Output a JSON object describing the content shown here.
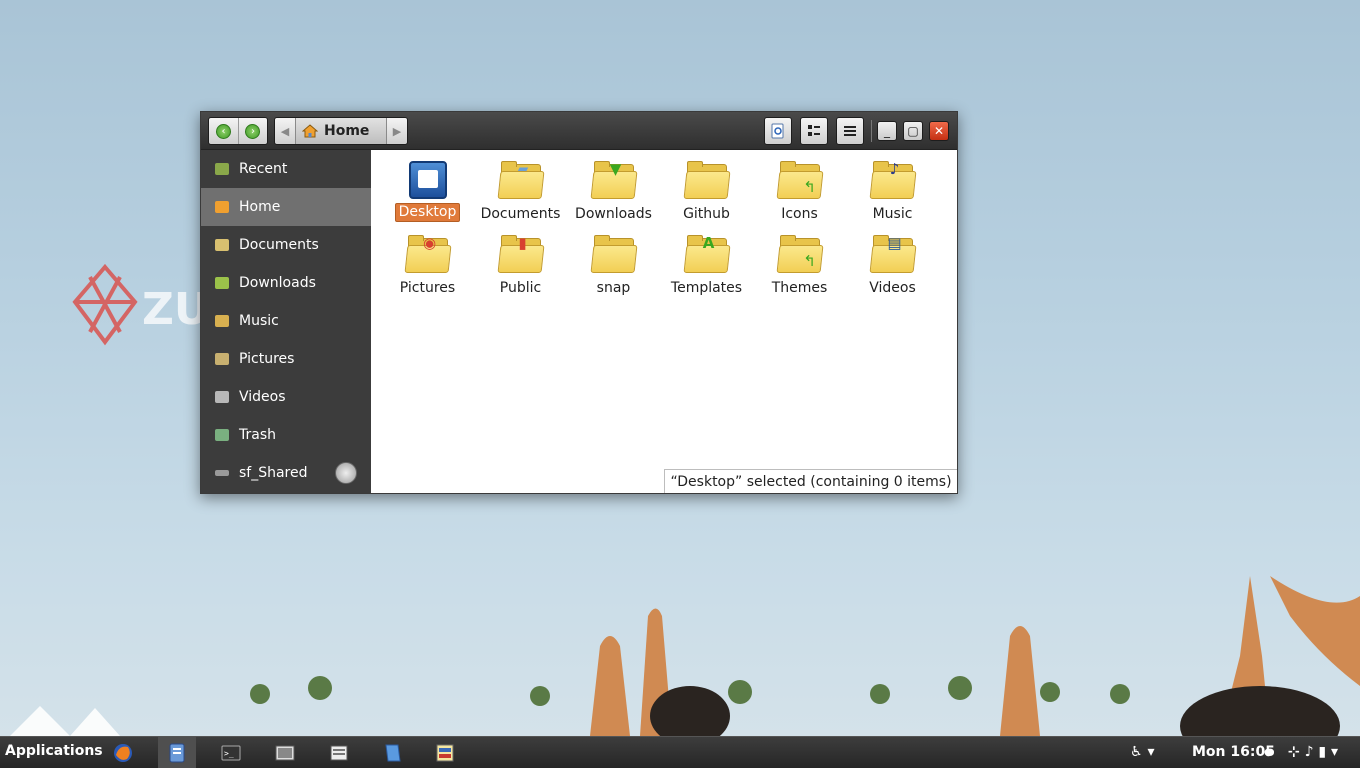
{
  "wallpaper": {
    "logo_text": "ZU"
  },
  "window": {
    "path": {
      "back_icon": "back-arrow-icon",
      "forward_icon": "forward-arrow-icon",
      "current": "Home"
    },
    "sidebar": [
      {
        "label": "Recent",
        "icon": "recent-icon"
      },
      {
        "label": "Home",
        "icon": "home-icon",
        "active": true
      },
      {
        "label": "Documents",
        "icon": "documents-icon"
      },
      {
        "label": "Downloads",
        "icon": "downloads-icon"
      },
      {
        "label": "Music",
        "icon": "music-icon"
      },
      {
        "label": "Pictures",
        "icon": "pictures-icon"
      },
      {
        "label": "Videos",
        "icon": "videos-icon"
      },
      {
        "label": "Trash",
        "icon": "trash-icon"
      },
      {
        "label": "sf_Shared",
        "icon": "shared-drive-icon"
      }
    ],
    "items": [
      {
        "label": "Desktop",
        "selected": true
      },
      {
        "label": "Documents"
      },
      {
        "label": "Downloads"
      },
      {
        "label": "Github"
      },
      {
        "label": "Icons"
      },
      {
        "label": "Music"
      },
      {
        "label": "Pictures"
      },
      {
        "label": "Public"
      },
      {
        "label": "snap"
      },
      {
        "label": "Templates"
      },
      {
        "label": "Themes"
      },
      {
        "label": "Videos"
      }
    ],
    "status": "“Desktop” selected  (containing 0 items)"
  },
  "taskbar": {
    "applications_label": "Applications",
    "clock": "Mon 16:05",
    "icons": [
      "firefox-icon",
      "file-manager-icon",
      "terminal-icon",
      "screenshot-icon",
      "document-viewer-icon",
      "text-editor-icon",
      "image-viewer-icon"
    ]
  },
  "colors": {
    "selection": "#e07a3a",
    "sidebar_bg": "#3c3c3c",
    "sidebar_active": "#707070"
  }
}
